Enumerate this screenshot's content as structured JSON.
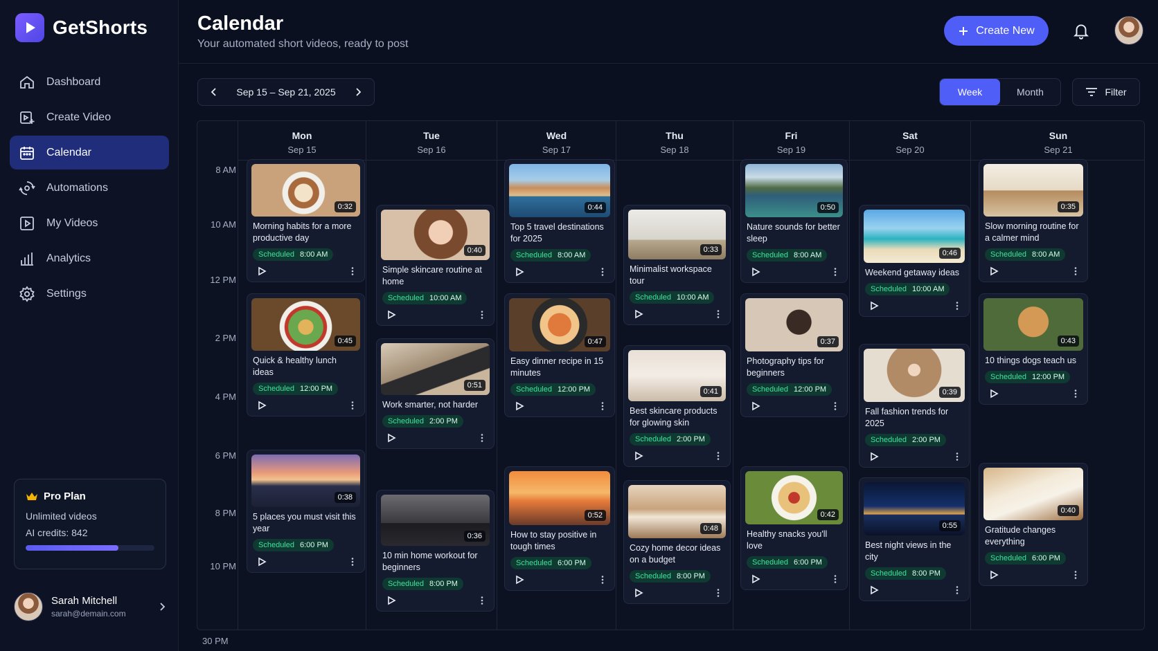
{
  "app": {
    "name": "GetShorts"
  },
  "sidebar": {
    "items": [
      {
        "label": "Dashboard",
        "icon": "home-icon"
      },
      {
        "label": "Create Video",
        "icon": "create-video-icon"
      },
      {
        "label": "Calendar",
        "icon": "calendar-icon",
        "active": true
      },
      {
        "label": "Automations",
        "icon": "automation-icon"
      },
      {
        "label": "My Videos",
        "icon": "video-play-icon"
      },
      {
        "label": "Analytics",
        "icon": "analytics-icon"
      },
      {
        "label": "Settings",
        "icon": "gear-icon"
      }
    ],
    "plan": {
      "title": "Pro Plan",
      "line1": "Unlimited videos",
      "line2": "AI credits: 842",
      "progress_fraction": 0.72
    },
    "user": {
      "name": "Sarah Mitchell",
      "email": "sarah@demain.com"
    }
  },
  "header": {
    "title": "Calendar",
    "subtitle": "Your automated short videos, ready to post",
    "create_label": "Create New"
  },
  "toolbar": {
    "date_range": "Sep 15 – Sep 21, 2025",
    "views": [
      "Week",
      "Month"
    ],
    "active_view": "Week",
    "filter_label": "Filter"
  },
  "times": [
    "8 AM",
    "10 AM",
    "12 PM",
    "2 PM",
    "4 PM",
    "6 PM",
    "8 PM",
    "10 PM",
    "30 PM"
  ],
  "days": [
    {
      "name": "Mon",
      "date": "Sep 15"
    },
    {
      "name": "Tue",
      "date": "Sep 16"
    },
    {
      "name": "Wed",
      "date": "Sep 17"
    },
    {
      "name": "Thu",
      "date": "Sep 18"
    },
    {
      "name": "Fri",
      "date": "Sep 19"
    },
    {
      "name": "Sat",
      "date": "Sep 20"
    },
    {
      "name": "Sun",
      "date": "Sep 21"
    }
  ],
  "status_label": "Scheduled",
  "colors": {
    "accent": "#4f5ef7",
    "status": "#3ee29f",
    "background": "#0b1020"
  },
  "videos": [
    {
      "day": 0,
      "title": "Morning habits for a more productive day",
      "time": "8:00 AM",
      "duration": "0:32",
      "thumbnail": "coffee-latte-art"
    },
    {
      "day": 0,
      "title": "Quick & healthy lunch ideas",
      "time": "12:00 PM",
      "duration": "0:45",
      "thumbnail": "salad-bowl"
    },
    {
      "day": 0,
      "title": "5 places you must visit this year",
      "time": "6:00 PM",
      "duration": "0:38",
      "thumbnail": "coastal-sunset"
    },
    {
      "day": 1,
      "title": "Simple skincare routine at home",
      "time": "10:00 AM",
      "duration": "0:40",
      "thumbnail": "smiling-woman"
    },
    {
      "day": 1,
      "title": "Work smarter, not harder",
      "time": "2:00 PM",
      "duration": "0:51",
      "thumbnail": "laptop-desk"
    },
    {
      "day": 1,
      "title": "10 min home workout for beginners",
      "time": "8:00 PM",
      "duration": "0:36",
      "thumbnail": "dumbbells"
    },
    {
      "day": 2,
      "title": "Top 5 travel destinations for 2025",
      "time": "8:00 AM",
      "duration": "0:44",
      "thumbnail": "seaside-village"
    },
    {
      "day": 2,
      "title": "Easy dinner recipe in 15 minutes",
      "time": "12:00 PM",
      "duration": "0:47",
      "thumbnail": "pasta-pan"
    },
    {
      "day": 2,
      "title": "How to stay positive in tough times",
      "time": "6:00 PM",
      "duration": "0:52",
      "thumbnail": "beach-sunset"
    },
    {
      "day": 3,
      "title": "Minimalist workspace tour",
      "time": "10:00 AM",
      "duration": "0:33",
      "thumbnail": "minimal-desk"
    },
    {
      "day": 3,
      "title": "Best skincare products for glowing skin",
      "time": "2:00 PM",
      "duration": "0:41",
      "thumbnail": "skincare-bottles"
    },
    {
      "day": 3,
      "title": "Cozy home decor ideas on a budget",
      "time": "8:00 PM",
      "duration": "0:48",
      "thumbnail": "cozy-bedroom"
    },
    {
      "day": 4,
      "title": "Nature sounds for better sleep",
      "time": "8:00 AM",
      "duration": "0:50",
      "thumbnail": "mountain-lake"
    },
    {
      "day": 4,
      "title": "Photography tips for beginners",
      "time": "12:00 PM",
      "duration": "0:37",
      "thumbnail": "photographer"
    },
    {
      "day": 4,
      "title": "Healthy snacks you'll love",
      "time": "6:00 PM",
      "duration": "0:42",
      "thumbnail": "pasta-salad"
    },
    {
      "day": 5,
      "title": "Weekend getaway ideas",
      "time": "10:00 AM",
      "duration": "0:46",
      "thumbnail": "tropical-beach"
    },
    {
      "day": 5,
      "title": "Fall fashion trends for 2025",
      "time": "2:00 PM",
      "duration": "0:39",
      "thumbnail": "fashion-coat"
    },
    {
      "day": 5,
      "title": "Best night views in the city",
      "time": "8:00 PM",
      "duration": "0:55",
      "thumbnail": "city-night"
    },
    {
      "day": 6,
      "title": "Slow morning routine for a calmer mind",
      "time": "8:00 AM",
      "duration": "0:35",
      "thumbnail": "morning-coffee"
    },
    {
      "day": 6,
      "title": "10 things dogs teach us",
      "time": "12:00 PM",
      "duration": "0:43",
      "thumbnail": "golden-retriever"
    },
    {
      "day": 6,
      "title": "Gratitude changes everything",
      "time": "6:00 PM",
      "duration": "0:40",
      "thumbnail": "journal-coffee"
    }
  ]
}
